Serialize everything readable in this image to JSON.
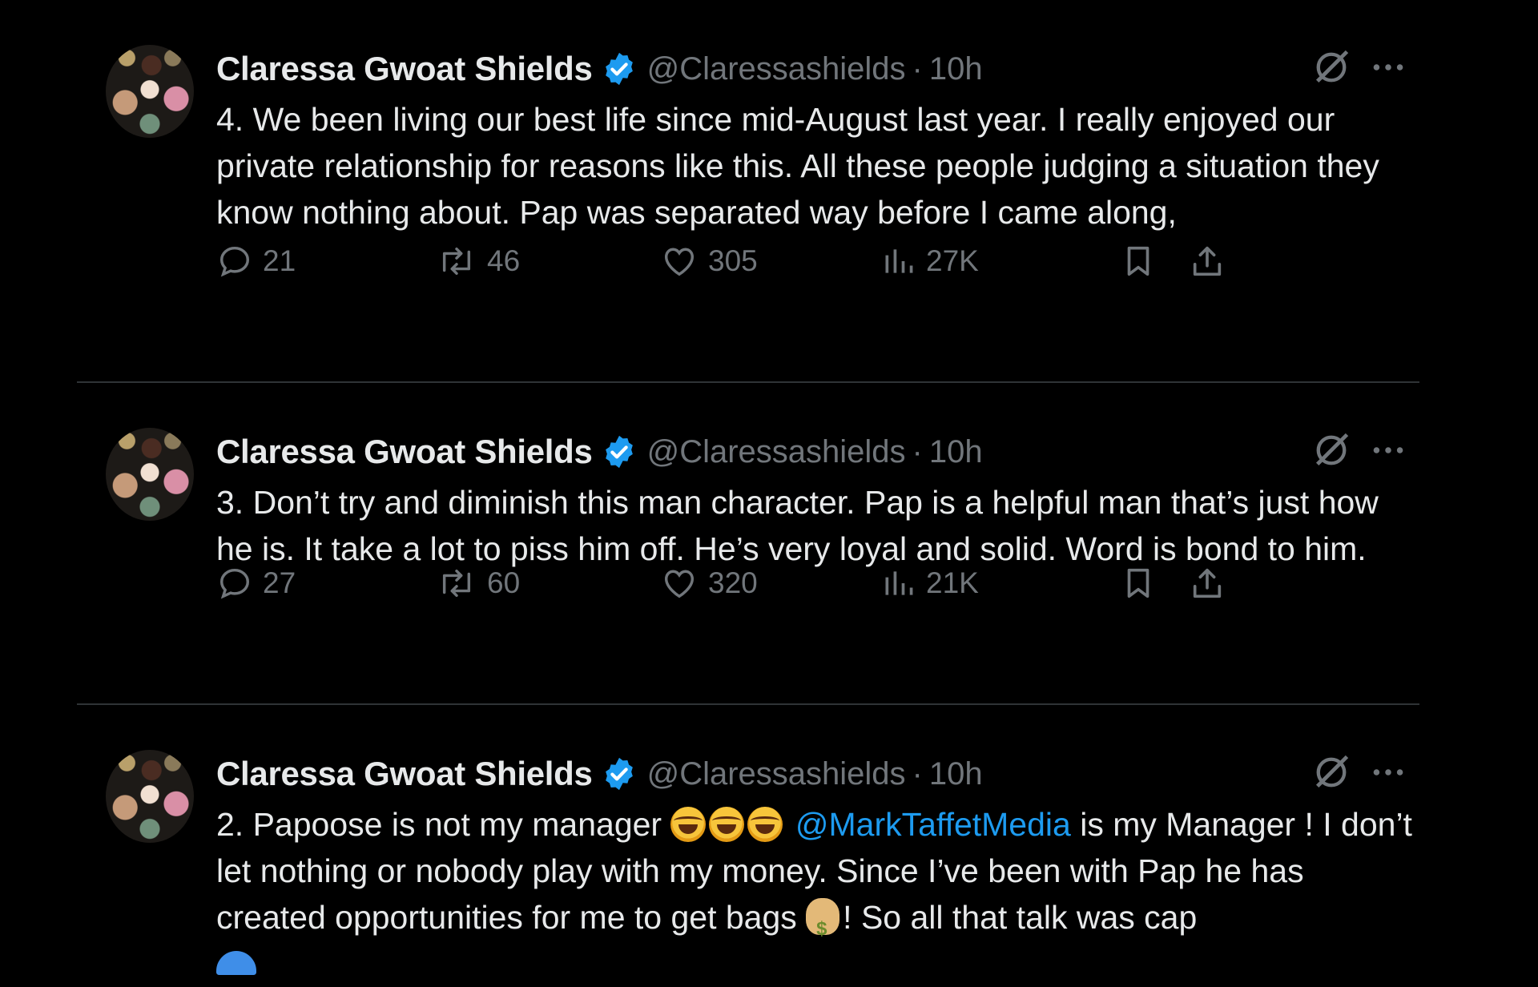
{
  "tweets": [
    {
      "author": {
        "name": "Claressa Gwoat Shields",
        "handle": "@Claressashields",
        "time": "10h"
      },
      "text": "4. We been living our best life since mid-August last year. I really enjoyed our private relationship for reasons like this. All these people judging a situation they know nothing about. Pap was separated way before I came along,",
      "stats": {
        "replies": "21",
        "reposts": "46",
        "likes": "305",
        "views": "27K"
      }
    },
    {
      "author": {
        "name": "Claressa Gwoat Shields",
        "handle": "@Claressashields",
        "time": "10h"
      },
      "text": "3. Don’t try and diminish this man character. Pap is a helpful man that’s just how he is. It take a lot to piss him off. He’s very loyal and solid. Word is bond to him.",
      "stats": {
        "replies": "27",
        "reposts": "60",
        "likes": "320",
        "views": "21K"
      }
    },
    {
      "author": {
        "name": "Claressa Gwoat Shields",
        "handle": "@Claressashields",
        "time": "10h"
      },
      "text_parts": {
        "prefix": "2. Papoose is not my manager ",
        "mention": "@MarkTaffetMedia",
        "middle": " is my Manager ! I don’t let nothing or nobody play with my money. Since I’ve been with Pap he has created opportunities for me to get bags ",
        "suffix": "! So all that talk was cap"
      }
    }
  ],
  "icons": {
    "verified": "verified-badge-icon",
    "grok": "grok-icon",
    "more": "more-options-icon",
    "reply": "reply-icon",
    "repost": "repost-icon",
    "like": "like-icon",
    "views": "views-icon",
    "bookmark": "bookmark-icon",
    "share": "share-icon"
  },
  "colors": {
    "background": "#000000",
    "text": "#e7e9ea",
    "muted": "#71767b",
    "accent": "#1d9bf0",
    "divider": "#2f3336"
  }
}
